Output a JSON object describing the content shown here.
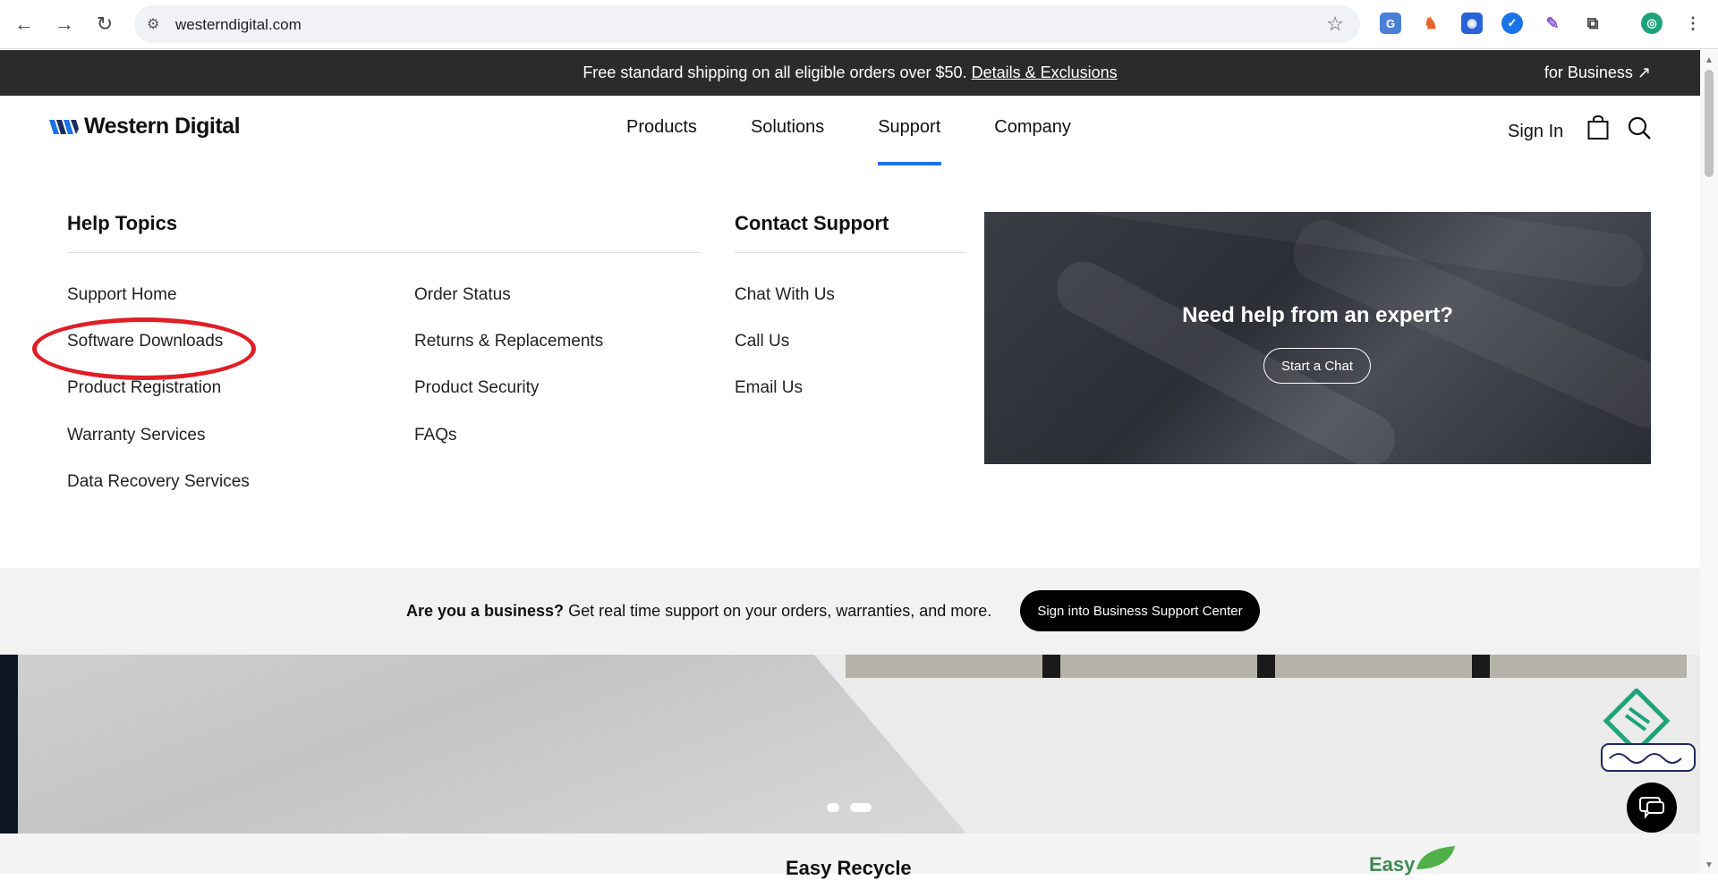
{
  "browser": {
    "url": "westerndigital.com",
    "extensions": [
      "translate-icon",
      "puzzle-chess-icon",
      "screen-icon",
      "check-badge-icon",
      "feather-icon",
      "extensions-icon",
      "profile-icon"
    ]
  },
  "promo_bar": {
    "text": "Free standard shipping on all eligible orders over $50.",
    "link": "Details & Exclusions",
    "business": "for Business ↗"
  },
  "header": {
    "brand": "Western Digital",
    "nav": [
      "Products",
      "Solutions",
      "Support",
      "Company"
    ],
    "active_nav": "Support",
    "sign_in": "Sign In"
  },
  "menu": {
    "help_title": "Help Topics",
    "help_col1": [
      "Support Home",
      "Software Downloads",
      "Product Registration",
      "Warranty Services",
      "Data Recovery Services"
    ],
    "help_col2": [
      "Order Status",
      "Returns & Replacements",
      "Product Security",
      "FAQs"
    ],
    "contact_title": "Contact Support",
    "contact_items": [
      "Chat With Us",
      "Call Us",
      "Email Us"
    ],
    "card_heading": "Need help from an expert?",
    "card_button": "Start a Chat"
  },
  "business_bar": {
    "bold": "Are you a business?",
    "text": " Get real time support on your orders, warranties, and more.",
    "button": "Sign into Business Support Center"
  },
  "bottom_strip": {
    "recycle": "Easy Recycle",
    "easy": "Easy"
  },
  "colors": {
    "accent": "#1a73e8",
    "annotation": "#e01e26",
    "promo_bg": "#2b2b2b"
  }
}
